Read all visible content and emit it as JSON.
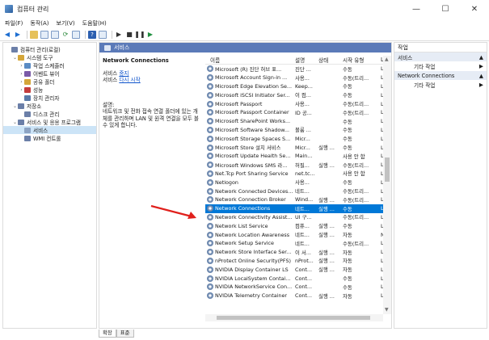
{
  "window": {
    "title": "컴퓨터 관리",
    "controls": [
      "—",
      "☐",
      "✕"
    ]
  },
  "menubar": [
    "파일(F)",
    "동작(A)",
    "보기(V)",
    "도움말(H)"
  ],
  "toolbar": {
    "icons": [
      "back-arrow-icon",
      "forward-arrow-icon",
      "folder-up-icon",
      "console-tree-icon",
      "properties-icon",
      "refresh-icon",
      "export-icon",
      "help-icon",
      "view-icon",
      "play-icon",
      "stop-icon",
      "pause-icon",
      "resume-icon"
    ],
    "colors": {
      "arrow": "#1f6fd1",
      "play": "#333333",
      "resume": "#1f8f3f"
    }
  },
  "tree": [
    {
      "label": "컴퓨터 관리(로컬)",
      "indent": 0,
      "exp": "",
      "color": "#6b7fa8"
    },
    {
      "label": "시스템 도구",
      "indent": 1,
      "exp": "⌄",
      "color": "#d4a639"
    },
    {
      "label": "작업 스케줄러",
      "indent": 2,
      "exp": "›",
      "color": "#5a8bc4"
    },
    {
      "label": "이벤트 뷰어",
      "indent": 2,
      "exp": "›",
      "color": "#7a5aa8"
    },
    {
      "label": "공유 폴더",
      "indent": 2,
      "exp": "›",
      "color": "#d4a639"
    },
    {
      "label": "성능",
      "indent": 2,
      "exp": "›",
      "color": "#c43c3c"
    },
    {
      "label": "장치 관리자",
      "indent": 2,
      "exp": "",
      "color": "#5a7aa8"
    },
    {
      "label": "저장소",
      "indent": 1,
      "exp": "⌄",
      "color": "#6b7fa8"
    },
    {
      "label": "디스크 관리",
      "indent": 2,
      "exp": "",
      "color": "#6b7fa8"
    },
    {
      "label": "서비스 및 응용 프로그램",
      "indent": 1,
      "exp": "⌄",
      "color": "#6b7fa8"
    },
    {
      "label": "서비스",
      "indent": 2,
      "exp": "",
      "color": "#8ca3c3",
      "selected": true
    },
    {
      "label": "WMI 컨트롤",
      "indent": 2,
      "exp": "",
      "color": "#6b7fa8"
    }
  ],
  "center": {
    "header": "서비스",
    "desc_title": "Network Connections",
    "action_prefix": "서비스",
    "action_stop": "중지",
    "action_restart": "다시 시작",
    "desc_label": "설명:",
    "desc_text": "네트워크 및 전화 접속 연결 폴더에 있는 개체를 관리하며 LAN 및 원격 연결을 모두 볼 수 있게 합니다."
  },
  "columns": [
    "이름",
    "설명",
    "상태",
    "시작 유형",
    "L^"
  ],
  "services": [
    [
      "Microsoft (R) 진단 허브 표...",
      "진단 ...",
      "",
      "수동",
      "L"
    ],
    [
      "Microsoft Account Sign-in ...",
      "사용...",
      "",
      "수동(트리...",
      "L"
    ],
    [
      "Microsoft Edge Elevation Se...",
      "Keep...",
      "",
      "수동",
      "L"
    ],
    [
      "Microsoft iSCSI Initiator Ser...",
      "이 컴...",
      "",
      "수동",
      "L"
    ],
    [
      "Microsoft Passport",
      "사용...",
      "",
      "수동(트리...",
      "L"
    ],
    [
      "Microsoft Passport Container",
      "ID 공...",
      "",
      "수동(트리...",
      "L"
    ],
    [
      "Microsoft SharePoint Works...",
      "",
      "",
      "수동",
      "L"
    ],
    [
      "Microsoft Software Shadow...",
      "볼륨 ...",
      "",
      "수동",
      "L"
    ],
    [
      "Microsoft Storage Spaces S...",
      "Micr...",
      "",
      "수동",
      "L"
    ],
    [
      "Microsoft Store 설치 서비스",
      "Micr...",
      "실행 ...",
      "수동",
      "L"
    ],
    [
      "Microsoft Update Health Se...",
      "Main...",
      "",
      "사용 안 함",
      "L"
    ],
    [
      "Microsoft Windows SMS 라...",
      "허필...",
      "실행 ...",
      "수동(트리...",
      "L"
    ],
    [
      "Net.Tcp Port Sharing Service",
      "net.tc...",
      "",
      "사용 안 함",
      "L"
    ],
    [
      "Netlogon",
      "사용...",
      "",
      "수동",
      "L"
    ],
    [
      "Network Connected Devices...",
      "네트...",
      "",
      "수동(트리...",
      "L"
    ],
    [
      "Network Connection Broker",
      "Wind...",
      "실행 ...",
      "수동(트리...",
      "L"
    ],
    [
      "Network Connections",
      "네트...",
      "실행 ...",
      "수동",
      "L"
    ],
    [
      "Network Connectivity Assist...",
      "UI 구...",
      "",
      "수동(트리...",
      "L"
    ],
    [
      "Network List Service",
      "컴퓨...",
      "실행 ...",
      "수동",
      "L"
    ],
    [
      "Network Location Awareness",
      "네트...",
      "실행 ...",
      "자동",
      "N"
    ],
    [
      "Network Setup Service",
      "네트...",
      "",
      "수동(트리...",
      "L"
    ],
    [
      "Network Store Interface Ser...",
      "이 서...",
      "실행 ...",
      "자동",
      "L"
    ],
    [
      "nProtect Online Security(PFS)",
      "nProt...",
      "실행 ...",
      "자동",
      "L"
    ],
    [
      "NVIDIA Display Container LS",
      "Cont...",
      "실행 ...",
      "자동",
      "L"
    ],
    [
      "NVIDIA LocalSystem Contai...",
      "Cont...",
      "",
      "수동",
      "L"
    ],
    [
      "NVIDIA NetworkService Con...",
      "Cont...",
      "",
      "수동",
      "L"
    ],
    [
      "NVIDIA Telemetry Container",
      "Cont...",
      "실행 ...",
      "자동",
      "L"
    ]
  ],
  "selected_service_index": 16,
  "tabs": [
    "확장",
    "표준"
  ],
  "actions": {
    "title": "작업",
    "sections": [
      {
        "header": "서비스",
        "item": "기타 작업"
      },
      {
        "header": "Network Connections",
        "item": "기타 작업"
      }
    ]
  },
  "annotation": {
    "color": "#e0201c"
  }
}
